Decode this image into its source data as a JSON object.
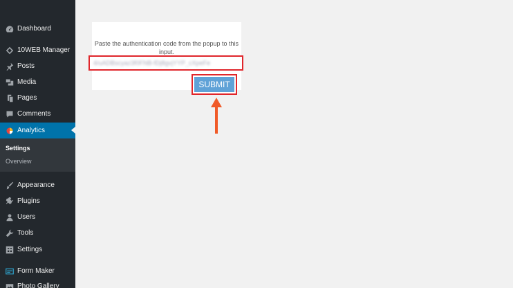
{
  "sidebar": {
    "items": [
      {
        "label": "Dashboard",
        "icon": "dashboard-icon"
      },
      {
        "label": "10WEB Manager",
        "icon": "tenweb-icon"
      },
      {
        "label": "Posts",
        "icon": "pin-icon"
      },
      {
        "label": "Media",
        "icon": "media-icon"
      },
      {
        "label": "Pages",
        "icon": "pages-icon"
      },
      {
        "label": "Comments",
        "icon": "comments-icon"
      },
      {
        "label": "Analytics",
        "icon": "analytics-icon"
      },
      {
        "label": "Appearance",
        "icon": "brush-icon"
      },
      {
        "label": "Plugins",
        "icon": "plugin-icon"
      },
      {
        "label": "Users",
        "icon": "users-icon"
      },
      {
        "label": "Tools",
        "icon": "wrench-icon"
      },
      {
        "label": "Settings",
        "icon": "settings-icon"
      },
      {
        "label": "Form Maker",
        "icon": "form-icon"
      },
      {
        "label": "Photo Gallery",
        "icon": "gallery-icon"
      }
    ],
    "submenu": [
      {
        "label": "Settings"
      },
      {
        "label": "Overview"
      }
    ]
  },
  "auth": {
    "instruction": "Paste the authentication code from the popup to this input.",
    "code_value": "4/uADBscyaz3f0FNB-fDj8gvjYYP_cXpeFe",
    "submit_label": "SUBMIT"
  },
  "colors": {
    "sidebar_bg": "#23282d",
    "active_bg": "#0073aa",
    "highlight_red": "#e0262b",
    "submit_blue": "#5fa2d7",
    "arrow": "#f05a28"
  }
}
